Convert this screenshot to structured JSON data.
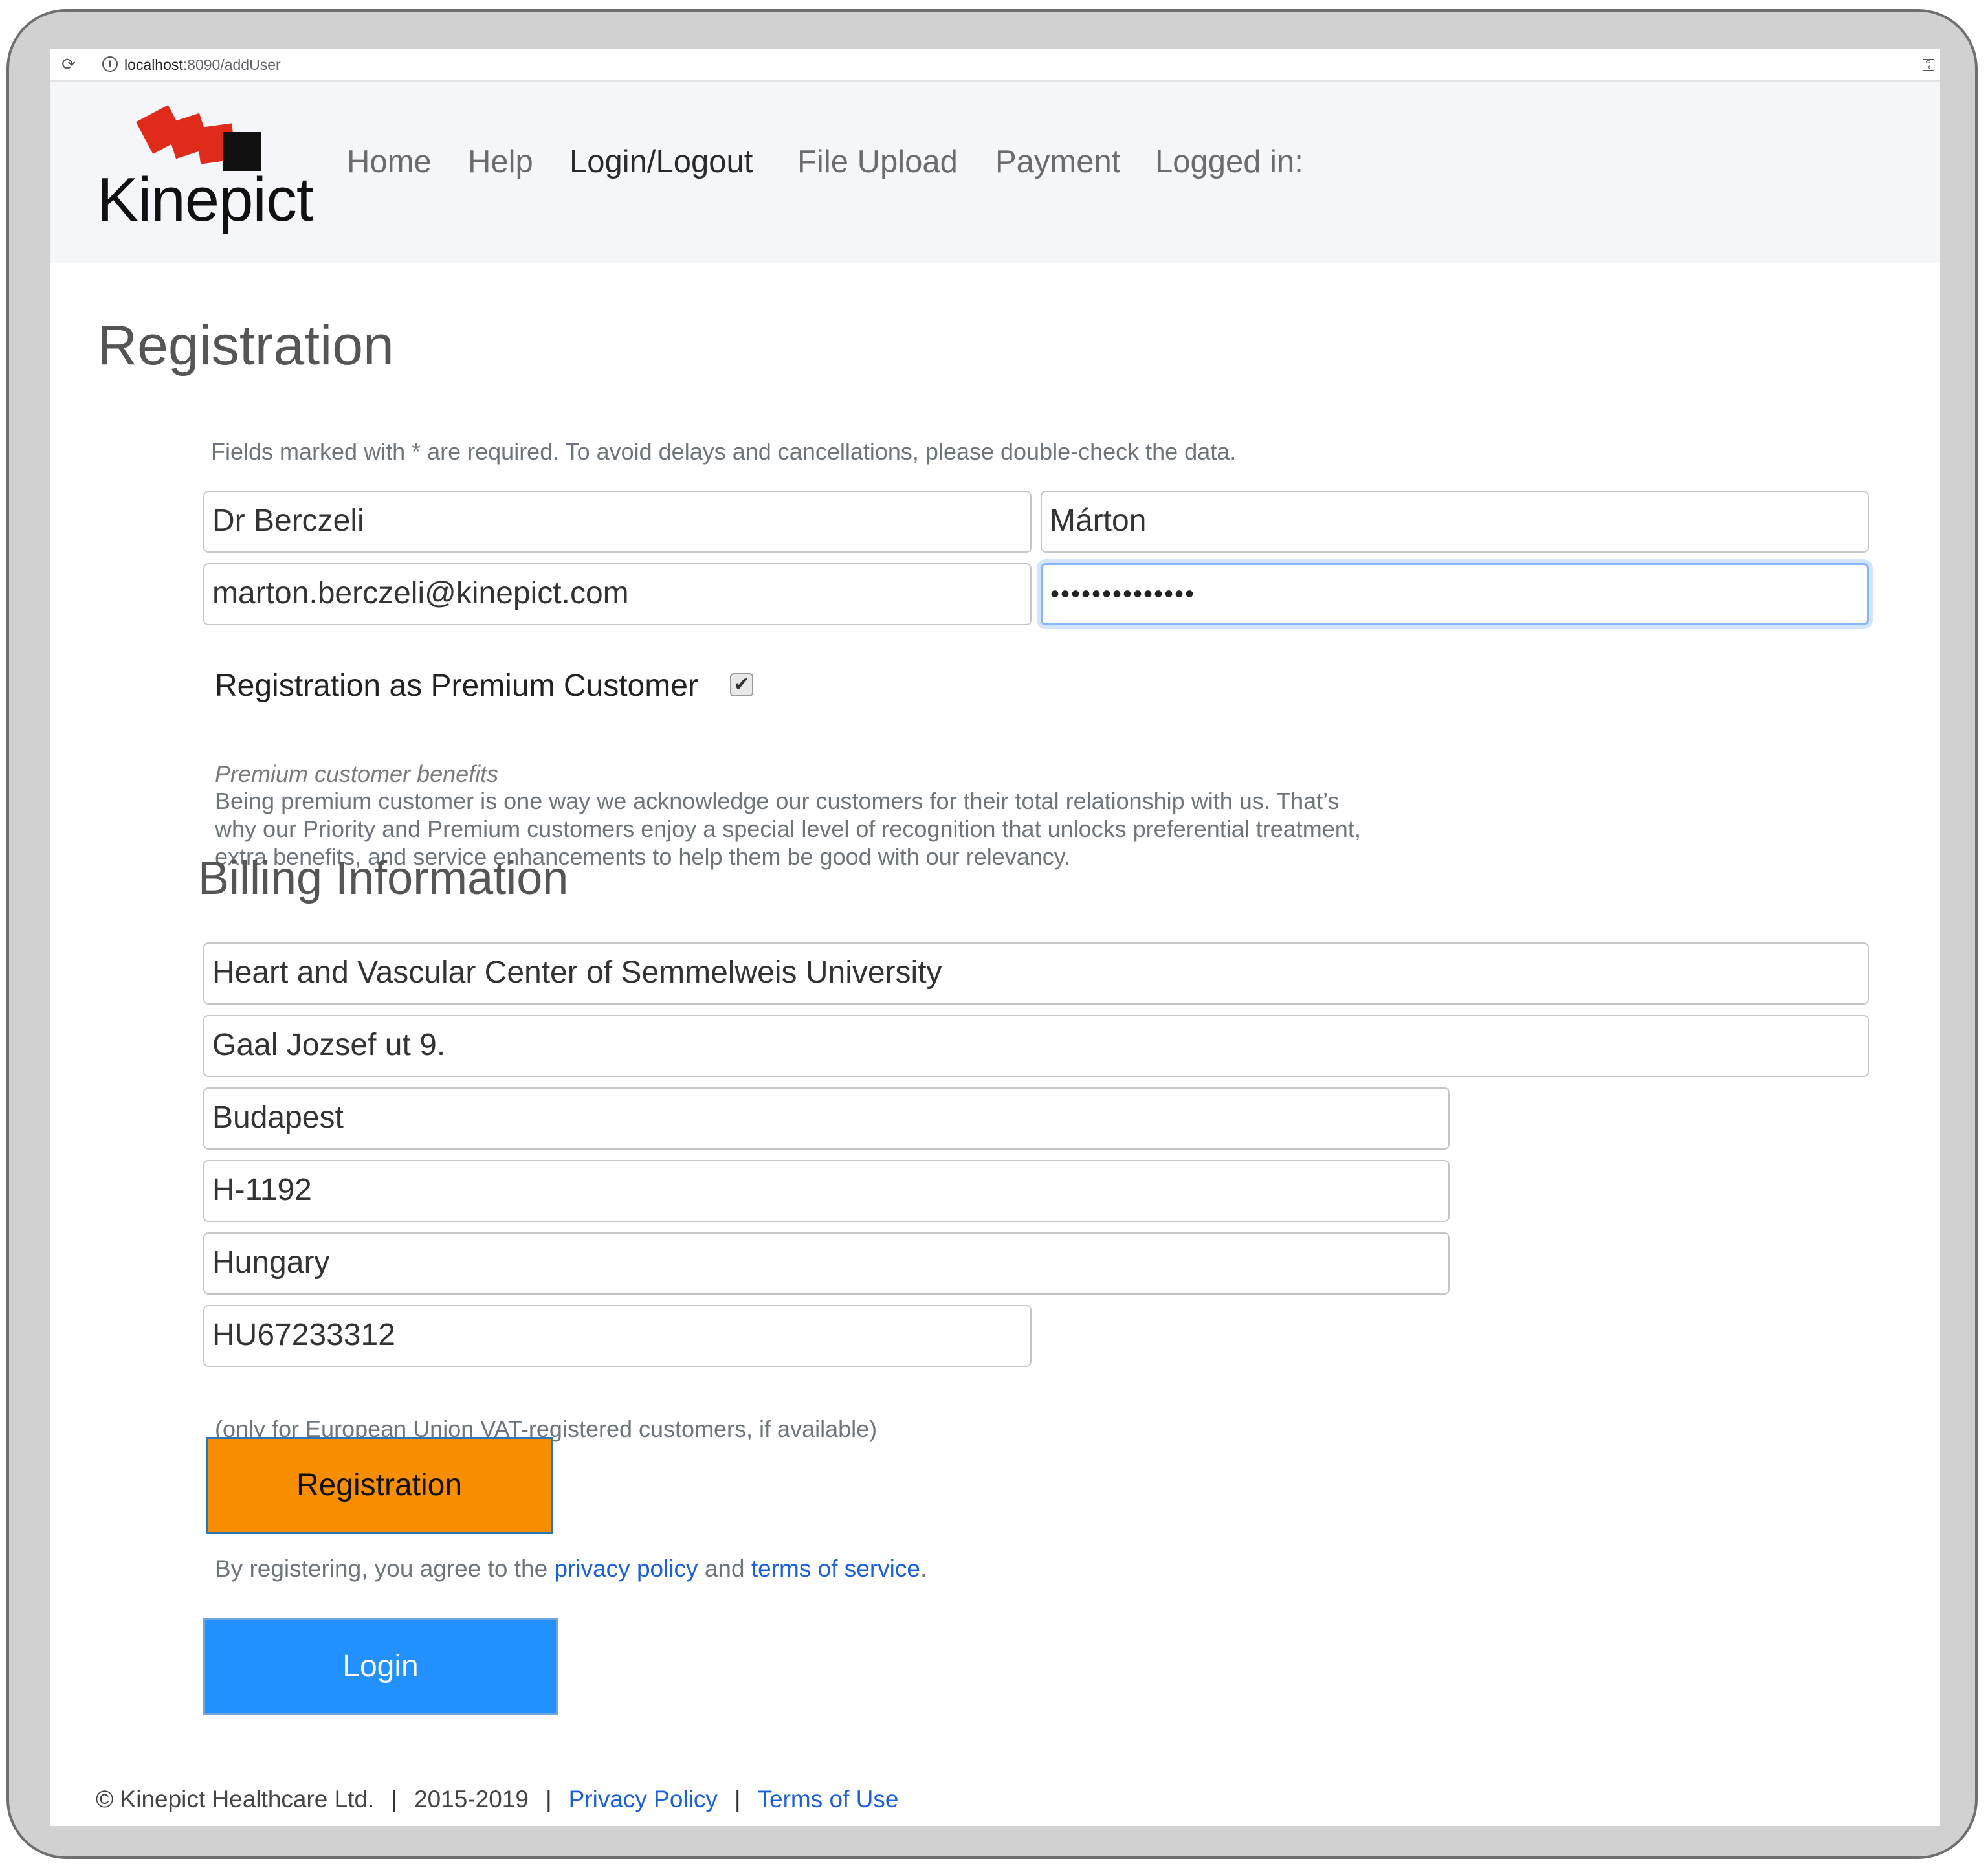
{
  "browser": {
    "url_host": "localhost",
    "url_rest": ":8090/addUser"
  },
  "header": {
    "logo_text": "Kinepict",
    "nav": [
      "Home",
      "Help",
      "Login/Logout",
      "File Upload",
      "Payment",
      "Logged in:"
    ],
    "active_nav": "Login/Logout",
    "logo_colors": {
      "red": "#e02a1a",
      "black": "#111111"
    }
  },
  "page": {
    "title": "Registration",
    "required_note": "Fields marked with * are required. To avoid delays and cancellations, please double-check the data."
  },
  "form": {
    "last_name": "Dr Berczeli",
    "first_name": "Márton",
    "email": "marton.berczeli@kinepict.com",
    "password_mask": "••••••••••••••",
    "premium_label": "Registration as Premium Customer",
    "premium_checked": true,
    "benefits_title": "Premium customer benefits",
    "benefits_lines": [
      "Being premium customer is one way we acknowledge our customers for their total relationship with us. That’s",
      "why our Priority and Premium customers enjoy a special level of recognition that unlocks preferential treatment,",
      "extra benefits, and service enhancements to help them be good with our relevancy."
    ]
  },
  "billing": {
    "title": "Billing Information",
    "company": "Heart and Vascular Center of Semmelweis University",
    "address": "Gaal Jozsef ut 9.",
    "city": "Budapest",
    "zip": "H-1192",
    "country": "Hungary",
    "vat": "HU67233312",
    "vat_note": "(only for European Union VAT-registered customers, if available)"
  },
  "actions": {
    "register_label": "Registration",
    "agree_prefix": "By registering, you agree to the ",
    "privacy_link": "privacy policy",
    "agree_and": " and ",
    "terms_link": "terms of service",
    "agree_suffix": ".",
    "login_label": "Login",
    "register_color": "#f78d00",
    "login_color": "#2290fe"
  },
  "footer": {
    "copyright": "© Kinepict Healthcare Ltd.",
    "years": "2015-2019",
    "privacy": "Privacy Policy",
    "terms": "Terms of Use",
    "separator": "|"
  }
}
